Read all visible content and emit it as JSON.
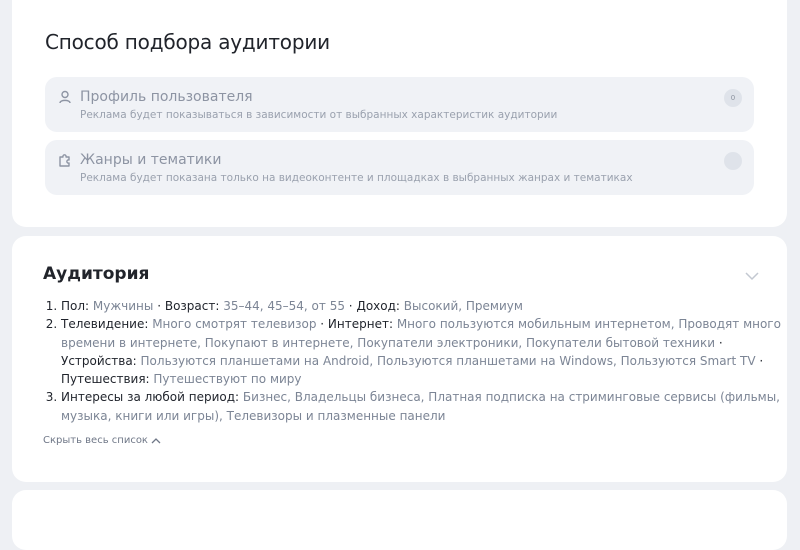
{
  "audience_selection": {
    "title": "Способ подбора аудитории",
    "options": [
      {
        "title": "Профиль пользователя",
        "description": "Реклама будет показываться в зависимости от выбранных характеристик аудитории",
        "badge": "0",
        "icon": "user-icon"
      },
      {
        "title": "Жанры и тематики",
        "description": "Реклама будет показана только на видеоконтенте и площадках в выбранных жанрах и тематиках",
        "badge": "",
        "icon": "puzzle-icon"
      }
    ]
  },
  "audience": {
    "title": "Аудитория",
    "items": [
      [
        {
          "k": "Пол: ",
          "v": "Мужчины"
        },
        {
          "sep": " · "
        },
        {
          "k": "Возраст: ",
          "v": "35–44, 45–54, от 55"
        },
        {
          "sep": " · "
        },
        {
          "k": "Доход: ",
          "v": "Высокий, Премиум"
        }
      ],
      [
        {
          "k": "Телевидение: ",
          "v": "Много смотрят телевизор"
        },
        {
          "sep": " · "
        },
        {
          "k": "Интернет: ",
          "v": "Много пользуются мобильным интернетом, Проводят много времени в интернете, Покупают в интернете, Покупатели электроники, Покупатели бытовой техники"
        },
        {
          "sep": " · "
        },
        {
          "k": "Устройства: ",
          "v": "Пользуются планшетами на Android, Пользуются планшетами на Windows, Пользуются Smart TV"
        },
        {
          "sep": " · "
        },
        {
          "k": "Путешествия: ",
          "v": "Путешествуют по миру"
        }
      ],
      [
        {
          "k": "Интересы за любой период: ",
          "v": "Бизнес, Владельцы бизнеса, Платная подписка на стриминговые сервисы (фильмы, музыка, книги или игры), Телевизоры и плазменные панели"
        }
      ]
    ],
    "hide_link": "Скрыть весь список"
  },
  "next_section": {
    "title_fragment": ""
  },
  "colors": {
    "background": "#eef0f4",
    "card": "#ffffff",
    "option_bg": "#f0f2f6",
    "value_text": "#7c8595"
  }
}
